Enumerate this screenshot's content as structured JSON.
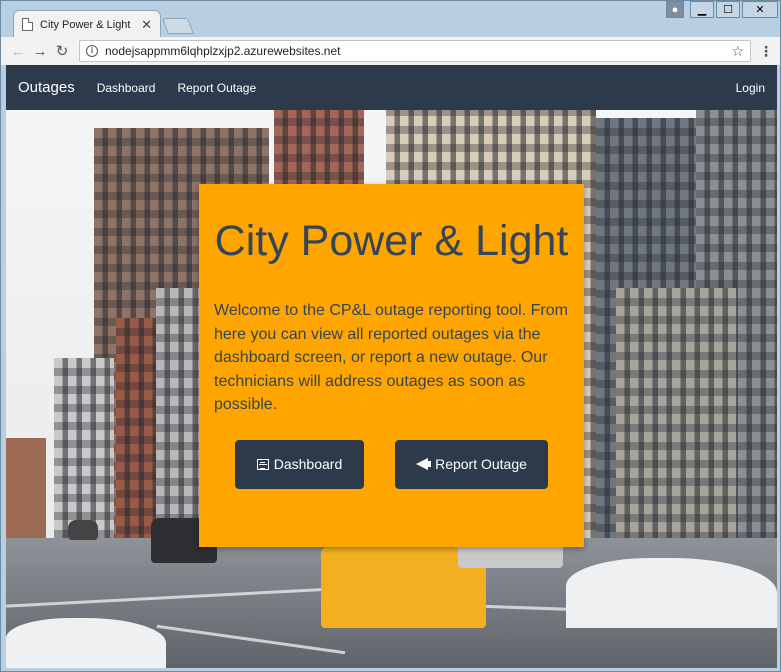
{
  "browser": {
    "tab_title": "City Power & Light",
    "url": "nodejsappmm6lqhplzxjp2.azurewebsites.net"
  },
  "navbar": {
    "brand": "Outages",
    "links": [
      "Dashboard",
      "Report Outage"
    ],
    "login": "Login"
  },
  "jumbotron": {
    "title": "City Power & Light",
    "text": "Welcome to the CP&L outage reporting tool. From here you can view all reported outages via the dashboard screen, or report a new outage. Our technicians will address outages as soon as possible.",
    "buttons": {
      "dashboard": "Dashboard",
      "report": "Report Outage"
    }
  },
  "colors": {
    "navbar": "#2c3a4b",
    "jumbotron": "#ffa500",
    "heading_text": "#354558"
  }
}
